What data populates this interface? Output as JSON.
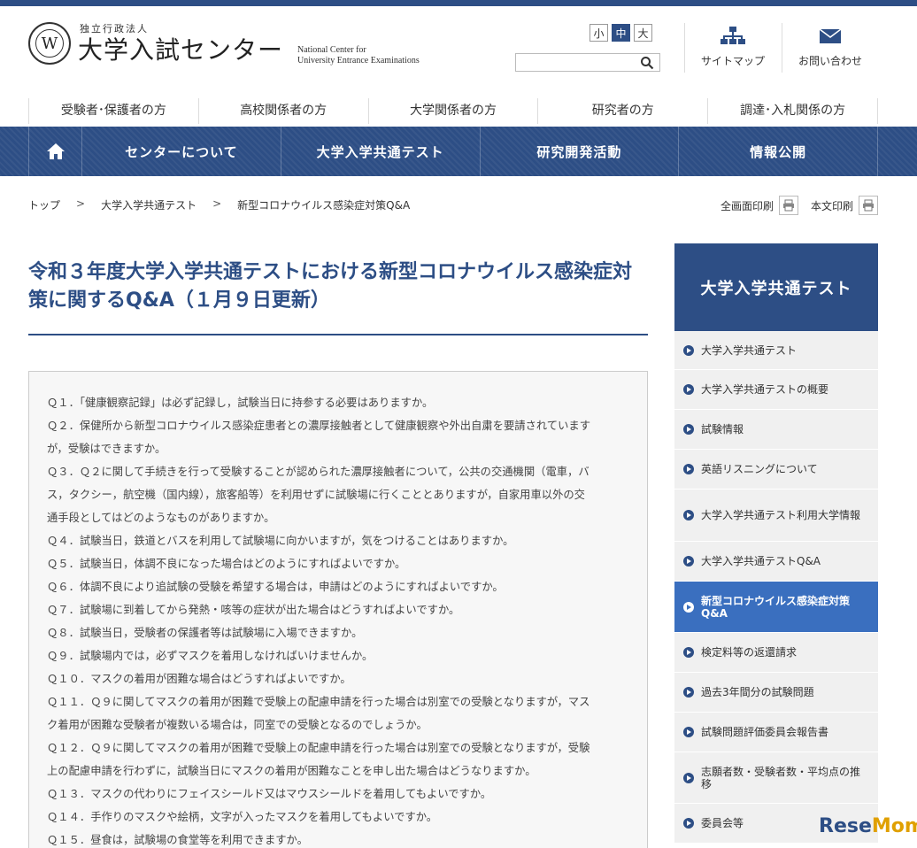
{
  "header": {
    "logo_small": "独立行政法人",
    "logo_main": "大学入試センター",
    "logo_en_line1": "National Center for",
    "logo_en_line2": "University Entrance Examinations",
    "font_sizes": [
      "小",
      "中",
      "大"
    ],
    "search_placeholder": "",
    "sitemap_label": "サイトマップ",
    "contact_label": "お問い合わせ"
  },
  "audience_nav": [
    "受験者･保護者の方",
    "高校関係者の方",
    "大学関係者の方",
    "研究者の方",
    "調達･入札関係の方"
  ],
  "main_nav": [
    "センターについて",
    "大学入学共通テスト",
    "研究開発活動",
    "情報公開"
  ],
  "breadcrumb": {
    "items": [
      "トップ",
      "大学入学共通テスト",
      "新型コロナウイルス感染症対策Q&A"
    ],
    "separator": ">"
  },
  "print": {
    "full_label": "全画面印刷",
    "text_label": "本文印刷"
  },
  "page_title": "令和３年度大学入学共通テストにおける新型コロナウイルス感染症対策に関するQ&A（１月９日更新）",
  "qa_lines": [
    "Ｑ１．「健康観察記録」は必ず記録し，試験当日に持参する必要はありますか。",
    "Ｑ２．保健所から新型コロナウイルス感染症患者との濃厚接触者として健康観察や外出自粛を要請されています",
    "が，受験はできますか。",
    "Ｑ３．Ｑ２に関して手続きを行って受験することが認められた濃厚接触者について，公共の交通機関（電車，バ",
    "ス，タクシー，航空機（国内線），旅客船等）を利用せずに試験場に行くこととありますが，自家用車以外の交",
    "通手段としてはどのようなものがありますか。",
    "Ｑ４．試験当日，鉄道とバスを利用して試験場に向かいますが，気をつけることはありますか。",
    "Ｑ５．試験当日，体調不良になった場合はどのようにすればよいですか。",
    "Ｑ６．体調不良により追試験の受験を希望する場合は，申請はどのようにすればよいですか。",
    "Ｑ７．試験場に到着してから発熱・咳等の症状が出た場合はどうすればよいですか。",
    "Ｑ８．試験当日，受験者の保護者等は試験場に入場できますか。",
    "Ｑ９．試験場内では，必ずマスクを着用しなければいけませんか。",
    "Ｑ１０．マスクの着用が困難な場合はどうすればよいですか。",
    "Ｑ１１．Ｑ９に関してマスクの着用が困難で受験上の配慮申請を行った場合は別室での受験となりますが，マス",
    "ク着用が困難な受験者が複数いる場合は，同室での受験となるのでしょうか。",
    "Ｑ１２．Ｑ９に関してマスクの着用が困難で受験上の配慮申請を行った場合は別室での受験となりますが，受験",
    "上の配慮申請を行わずに，試験当日にマスクの着用が困難なことを申し出た場合はどうなりますか。",
    "Ｑ１３．マスクの代わりにフェイスシールド又はマウスシールドを着用してもよいですか。",
    "Ｑ１４．手作りのマスクや絵柄，文字が入ったマスクを着用してもよいですか。",
    "Ｑ１５．昼食は，試験場の食堂等を利用できますか。"
  ],
  "side_nav": {
    "title": "大学入学共通テスト",
    "items": [
      "大学入学共通テスト",
      "大学入学共通テストの概要",
      "試験情報",
      "英語リスニングについて",
      "大学入学共通テスト利用大学情報",
      "大学入学共通テストQ&A",
      "新型コロナウイルス感染症対策Q&A",
      "検定料等の返還請求",
      "過去3年間分の試験問題",
      "試験問題評価委員会報告書",
      "志願者数・受験者数・平均点の推移",
      "委員会等"
    ],
    "active_index": 6
  },
  "watermark": {
    "part1": "Rese",
    "part2": "Mom"
  },
  "colors": {
    "primary": "#2d4e85",
    "active": "#3a6fbf"
  }
}
